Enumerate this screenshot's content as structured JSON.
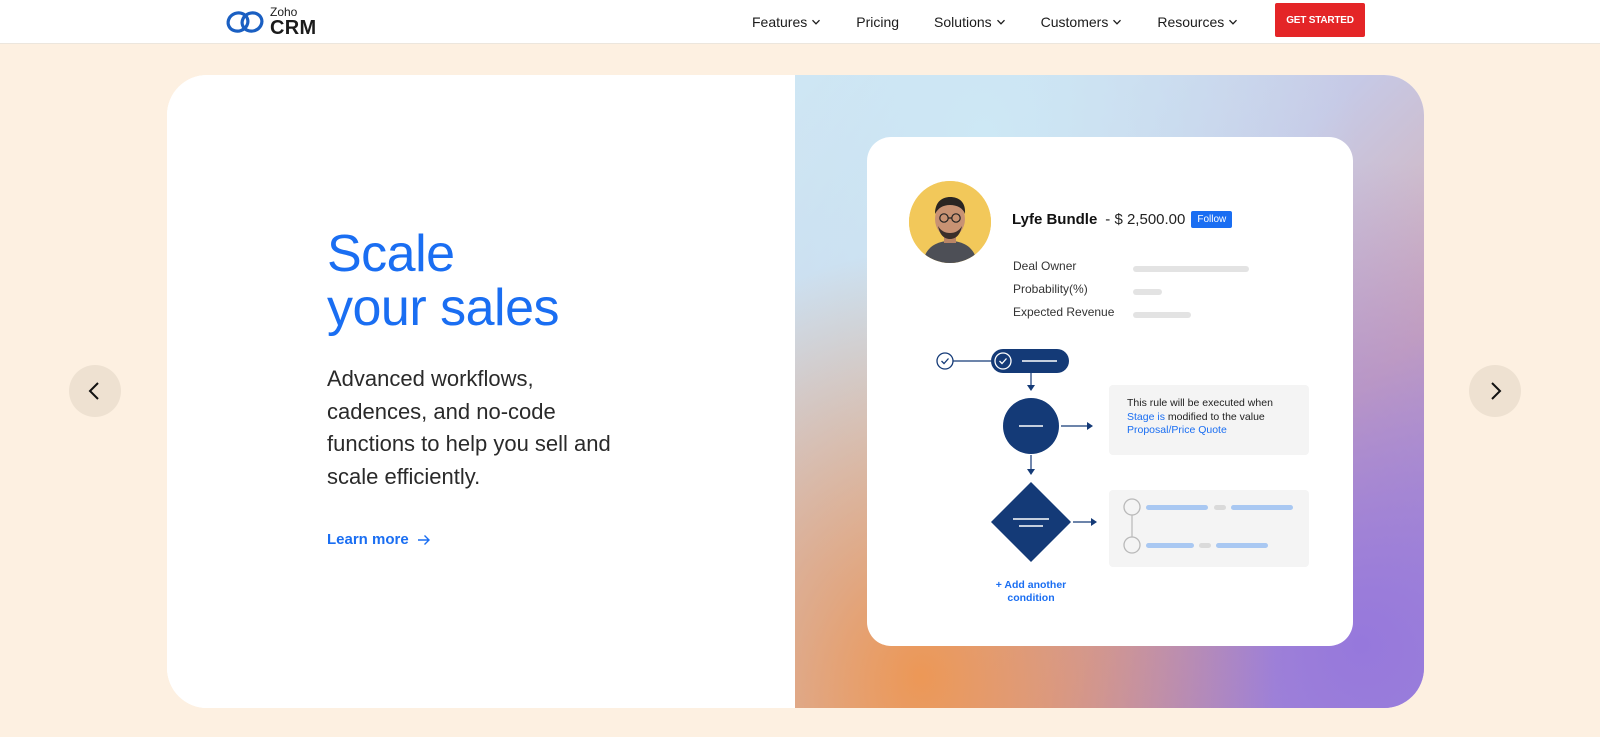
{
  "header": {
    "logo": {
      "brand": "Zoho",
      "product": "CRM"
    },
    "nav": [
      {
        "label": "Features",
        "has_dropdown": true
      },
      {
        "label": "Pricing",
        "has_dropdown": false
      },
      {
        "label": "Solutions",
        "has_dropdown": true
      },
      {
        "label": "Customers",
        "has_dropdown": true
      },
      {
        "label": "Resources",
        "has_dropdown": true
      }
    ],
    "cta_label": "GET STARTED"
  },
  "hero": {
    "headline_line1": "Scale",
    "headline_line2": "your sales",
    "description": "Advanced workflows, cadences, and no-code functions to help you sell and scale efficiently.",
    "learn_more": "Learn more"
  },
  "illustration": {
    "deal_name": "Lyfe Bundle",
    "deal_amount": "- $ 2,500.00",
    "follow_label": "Follow",
    "fields": [
      "Deal Owner",
      "Probability(%)",
      "Expected Revenue"
    ],
    "rule_text_1": "This rule will be executed when",
    "rule_text_2a": "Stage is",
    "rule_text_2b": " modified to the value",
    "rule_text_3": "Proposal/Price Quote",
    "add_condition": "+ Add another condition"
  },
  "icons": {
    "prev": "chevron-left-icon",
    "next": "chevron-right-icon",
    "arrow": "arrow-right-icon",
    "dropdown": "chevron-down-icon"
  },
  "colors": {
    "accent_blue": "#1a6ef2",
    "cta_red": "#e42527",
    "page_bg": "#fdf0e1",
    "navy": "#143a77"
  }
}
